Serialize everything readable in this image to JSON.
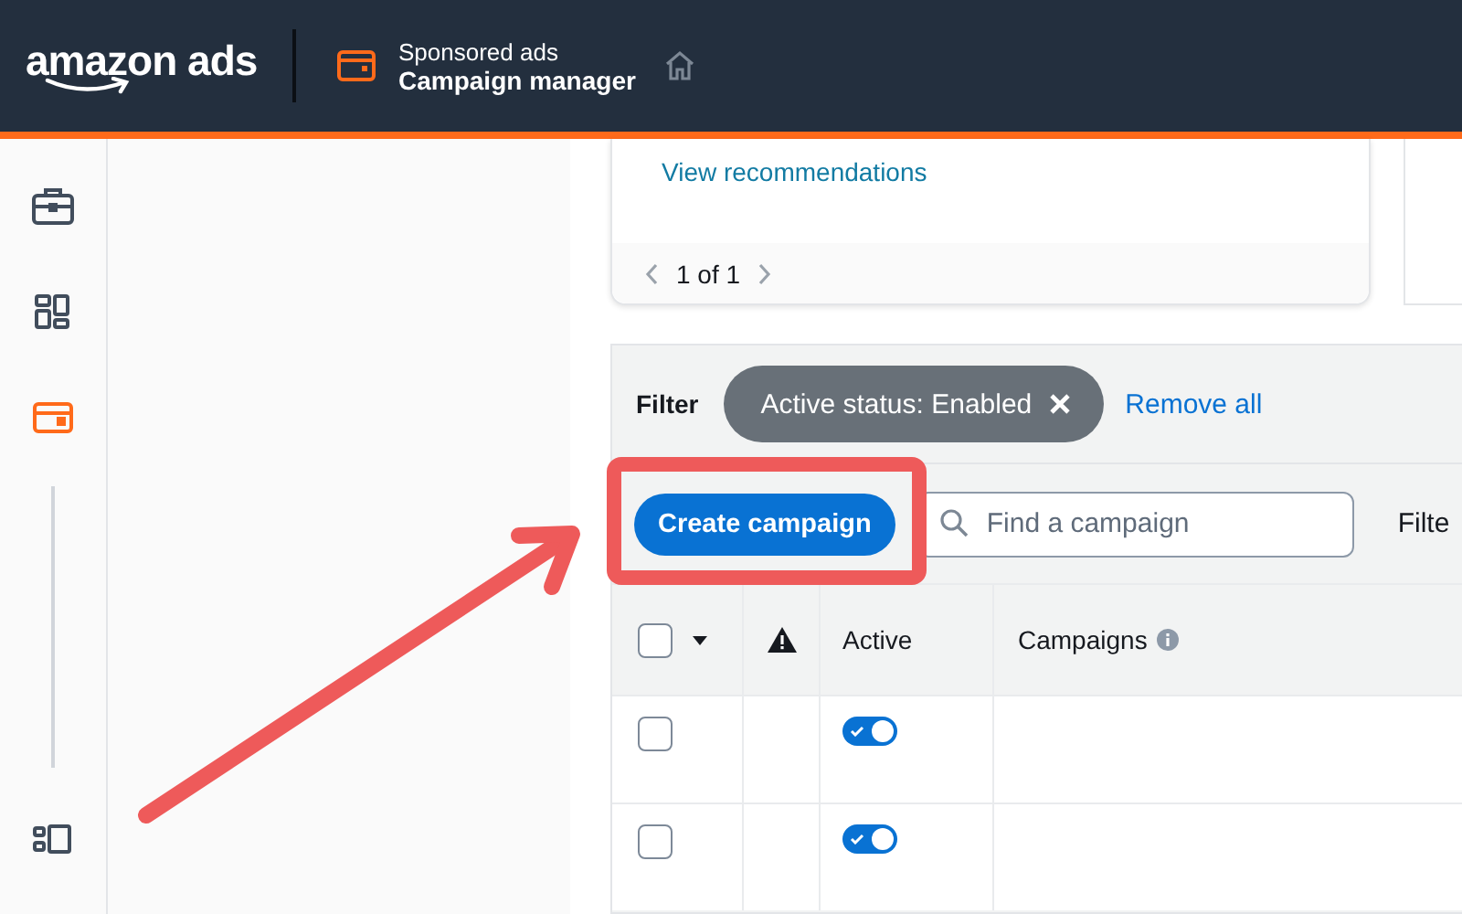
{
  "header": {
    "logo": "amazon ads",
    "product_label": "Sponsored ads",
    "product_title": "Campaign manager"
  },
  "rail": [
    {
      "kind": "briefcase",
      "selected": false
    },
    {
      "kind": "dashboard",
      "selected": false
    },
    {
      "kind": "card",
      "selected": true
    },
    {
      "kind": "divider"
    },
    {
      "kind": "layout",
      "selected": false
    }
  ],
  "recommendation_card": {
    "link": "View recommendations",
    "pager": "1 of 1"
  },
  "filter": {
    "label": "Filter",
    "chip": "Active status: Enabled",
    "remove": "Remove all"
  },
  "toolbar": {
    "create_button": "Create campaign",
    "search_placeholder": "Find a campaign",
    "cut_text": "Filte"
  },
  "table": {
    "header_checked": false,
    "columns": [
      "Active",
      "Campaigns"
    ],
    "rows": [
      {
        "checked": false,
        "active": true
      },
      {
        "checked": false,
        "active": true
      }
    ]
  }
}
